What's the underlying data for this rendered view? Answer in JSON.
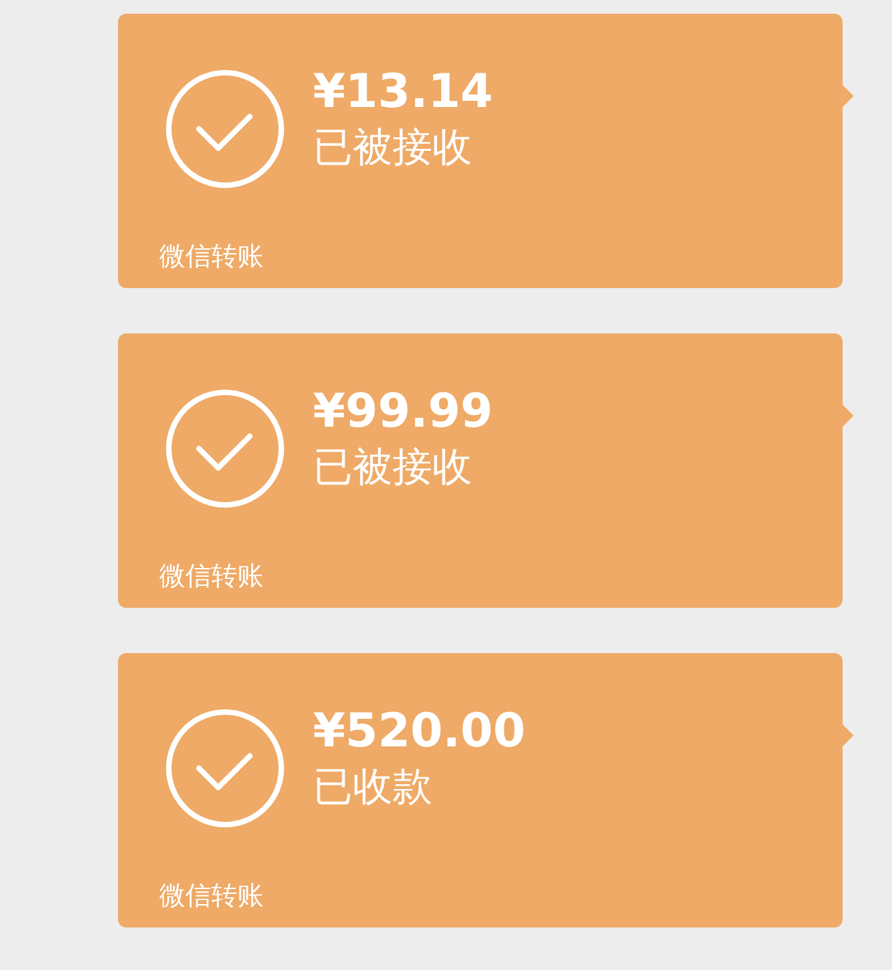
{
  "transfers": [
    {
      "amount": "¥13.14",
      "status": "已被接收",
      "footer": "微信转账"
    },
    {
      "amount": "¥99.99",
      "status": "已被接收",
      "footer": "微信转账"
    },
    {
      "amount": "¥520.00",
      "status": "已收款",
      "footer": "微信转账"
    }
  ]
}
